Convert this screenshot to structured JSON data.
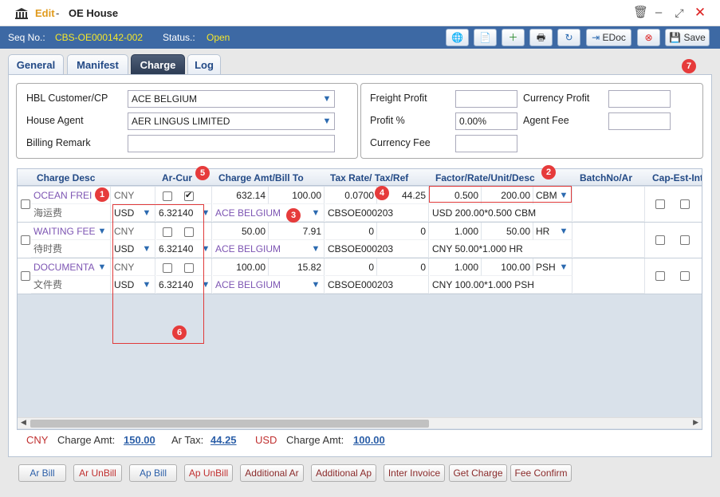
{
  "window": {
    "edit_label": "Edit",
    "sep": "-",
    "title": "OE House"
  },
  "status_bar": {
    "seq_label": "Seq No.:",
    "seq_value": "CBS-OE000142-002",
    "status_label": "Status.:",
    "status_value": "Open"
  },
  "toolbar": {
    "edoc_label": "EDoc",
    "save_label": "Save"
  },
  "tabs": [
    "General",
    "Manifest",
    "Charge",
    "Log"
  ],
  "form": {
    "hbl_customer_label": "HBL Customer/CP",
    "hbl_customer_value": "ACE BELGIUM",
    "house_agent_label": "House Agent",
    "house_agent_value": "AER LINGUS LIMITED",
    "billing_remark_label": "Billing Remark",
    "billing_remark_value": "",
    "freight_profit_label": "Freight Profit",
    "currency_profit_label": "Currency Profit",
    "profit_pct_label": "Profit %",
    "profit_pct_value": "0.00%",
    "agent_fee_label": "Agent Fee",
    "currency_fee_label": "Currency Fee"
  },
  "grid": {
    "headers": [
      "Charge Desc",
      "Ar-Cur",
      "Charge Amt/Bill To",
      "Tax Rate/ Tax/Ref",
      "Factor/Rate/Unit/Desc",
      "BatchNo/Ar",
      "Cap-Est-Int"
    ],
    "rows": [
      {
        "desc": "OCEAN FREI",
        "desc_cn": "海运费",
        "cur": "CNY",
        "ar_cur": "USD",
        "ex_rate": "6.32140",
        "amt": "632.14",
        "bill_amt": "100.00",
        "bill_to": "ACE BELGIUM",
        "tax_rate": "0.0700",
        "tax": "44.25",
        "ref": "CBSOE000203",
        "factor": "0.500",
        "rate": "200.00",
        "unit": "CBM",
        "desc2": "USD 200.00*0.500 CBM",
        "chk2": true
      },
      {
        "desc": "WAITING FEE",
        "desc_cn": "待时费",
        "cur": "CNY",
        "ar_cur": "USD",
        "ex_rate": "6.32140",
        "amt": "50.00",
        "bill_amt": "7.91",
        "bill_to": "ACE BELGIUM",
        "tax_rate": "0",
        "tax": "0",
        "ref": "CBSOE000203",
        "factor": "1.000",
        "rate": "50.00",
        "unit": "HR",
        "desc2": "CNY 50.00*1.000 HR",
        "chk2": false
      },
      {
        "desc": "DOCUMENTA",
        "desc_cn": "文件费",
        "cur": "CNY",
        "ar_cur": "USD",
        "ex_rate": "6.32140",
        "amt": "100.00",
        "bill_amt": "15.82",
        "bill_to": "ACE BELGIUM",
        "tax_rate": "0",
        "tax": "0",
        "ref": "CBSOE000203",
        "factor": "1.000",
        "rate": "100.00",
        "unit": "PSH",
        "desc2": "CNY 100.00*1.000 PSH",
        "chk2": false
      }
    ]
  },
  "summary": {
    "cur1": "CNY",
    "charge_amt_label": "Charge Amt:",
    "charge_amt1": "150.00",
    "ar_tax_label": "Ar Tax:",
    "ar_tax": "44.25",
    "cur2": "USD",
    "charge_amt_label2": "Charge Amt:",
    "charge_amt2": "100.00"
  },
  "buttons": [
    "Ar Bill",
    "Ar UnBill",
    "Ap Bill",
    "Ap UnBill",
    "Additional Ar",
    "Additional Ap",
    "Inter Invoice",
    "Get Charge",
    "Fee Confirm"
  ],
  "markers": [
    "1",
    "2",
    "3",
    "4",
    "5",
    "6",
    "7"
  ],
  "colors": {
    "status_bar": "#3d69a4",
    "accent_yellow": "#f5e72a",
    "link_purple": "#7d55b3",
    "marker_red": "#e63b3b"
  }
}
